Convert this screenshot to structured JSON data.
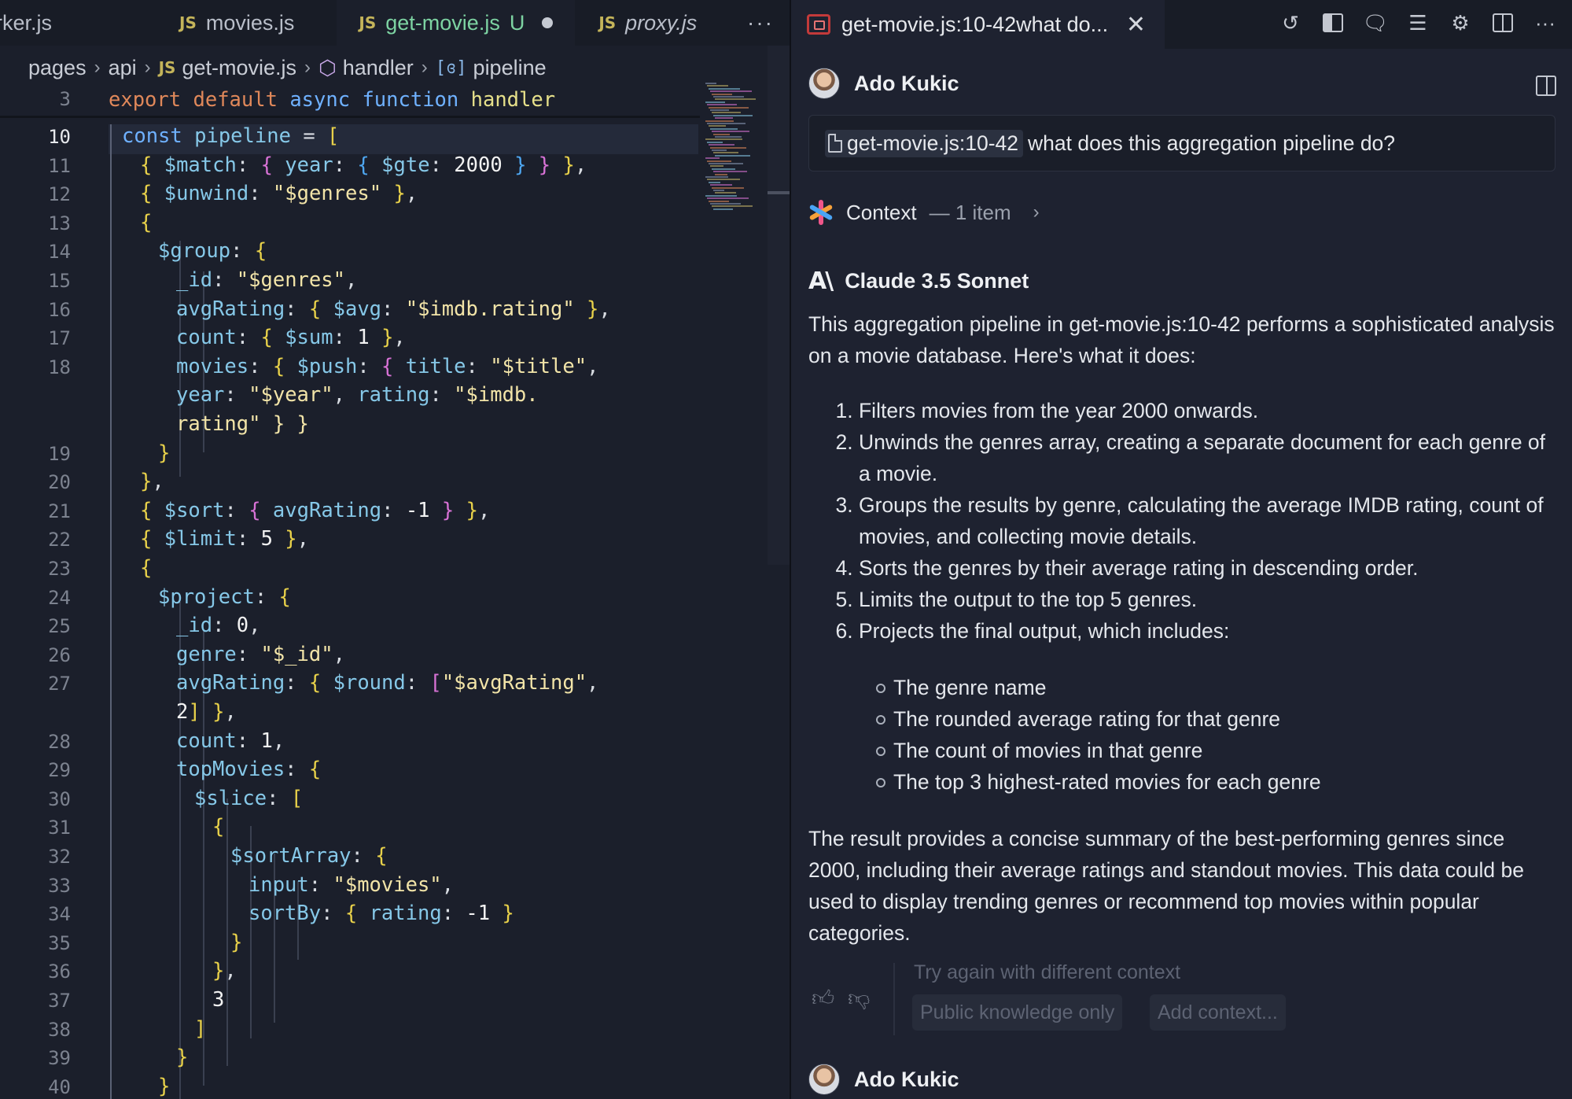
{
  "editor": {
    "tabs": [
      {
        "label": "rker.js",
        "badge": ""
      },
      {
        "label": "movies.js",
        "badge": "JS"
      },
      {
        "label": "get-movie.js",
        "badge": "JS",
        "status": "U"
      },
      {
        "label": "proxy.js",
        "badge": "JS"
      }
    ],
    "tab_more": "···",
    "breadcrumb": [
      "pages",
      "api",
      "get-movie.js",
      "handler",
      "pipeline"
    ],
    "sticky_line_number": "3",
    "line_numbers": [
      "10",
      "11",
      "12",
      "13",
      "14",
      "15",
      "16",
      "17",
      "18",
      "",
      "",
      "19",
      "20",
      "21",
      "22",
      "23",
      "24",
      "25",
      "26",
      "27",
      "",
      "28",
      "29",
      "30",
      "31",
      "32",
      "33",
      "34",
      "35",
      "36",
      "37",
      "38",
      "39",
      "40"
    ],
    "code_lines": [
      "const pipeline = [",
      "{ $match: { year: { $gte: 2000 } } },",
      "{ $unwind: \"$genres\" },",
      "{",
      "$group: {",
      "_id: \"$genres\",",
      "avgRating: { $avg: \"$imdb.rating\" },",
      "count: { $sum: 1 },",
      "movies: { $push: { title: \"$title\",",
      "year: \"$year\", rating: \"$imdb.",
      "rating\" } }",
      "}",
      "},",
      "{ $sort: { avgRating: -1 } },",
      "{ $limit: 5 },",
      "{",
      "$project: {",
      "_id: 0,",
      "genre: \"$_id\",",
      "avgRating: { $round: [\"$avgRating\",",
      "2] },",
      "count: 1,",
      "topMovies: {",
      "$slice: [",
      "{",
      "$sortArray: {",
      "input: \"$movies\",",
      "sortBy: { rating: -1 }",
      "}",
      "},",
      "3",
      "]",
      "}",
      "}"
    ],
    "sticky_code": "export default async function handler"
  },
  "chat": {
    "tab_title": "get-movie.js:10-42what do...",
    "user_name": "Ado Kukic",
    "query_ref": "get-movie.js:10-42",
    "query_text": "what does this aggregation pipeline do?",
    "context_label": "Context",
    "context_count": "— 1 item",
    "model_name": "Claude 3.5 Sonnet",
    "answer_intro": "This aggregation pipeline in get-movie.js:10-42 performs a sophisticated analysis on a movie database. Here's what it does:",
    "answer_steps": [
      "Filters movies from the year 2000 onwards.",
      "Unwinds the genres array, creating a separate document for each genre of a movie.",
      "Groups the results by genre, calculating the average IMDB rating, count of movies, and collecting movie details.",
      "Sorts the genres by their average rating in descending order.",
      "Limits the output to the top 5 genres.",
      "Projects the final output, which includes:"
    ],
    "answer_subitems": [
      "The genre name",
      "The rounded average rating for that genre",
      "The count of movies in that genre",
      "The top 3 highest-rated movies for each genre"
    ],
    "answer_summary": "The result provides a concise summary of the best-performing genres since 2000, including their average ratings and standout movies. This data could be used to display trending genres or recommend top movies within popular categories.",
    "retry_label": "Try again with different context",
    "chip_public": "Public knowledge only",
    "chip_add": "Add context...",
    "user2_name": "Ado Kukic"
  },
  "colors": {
    "editor_bg": "#1b1f2b",
    "chat_bg": "#1e2230",
    "active_tab_text": "#7dd3a2",
    "keyword": "#e0885a",
    "property": "#86c8e8",
    "string": "#f2e4a8"
  }
}
